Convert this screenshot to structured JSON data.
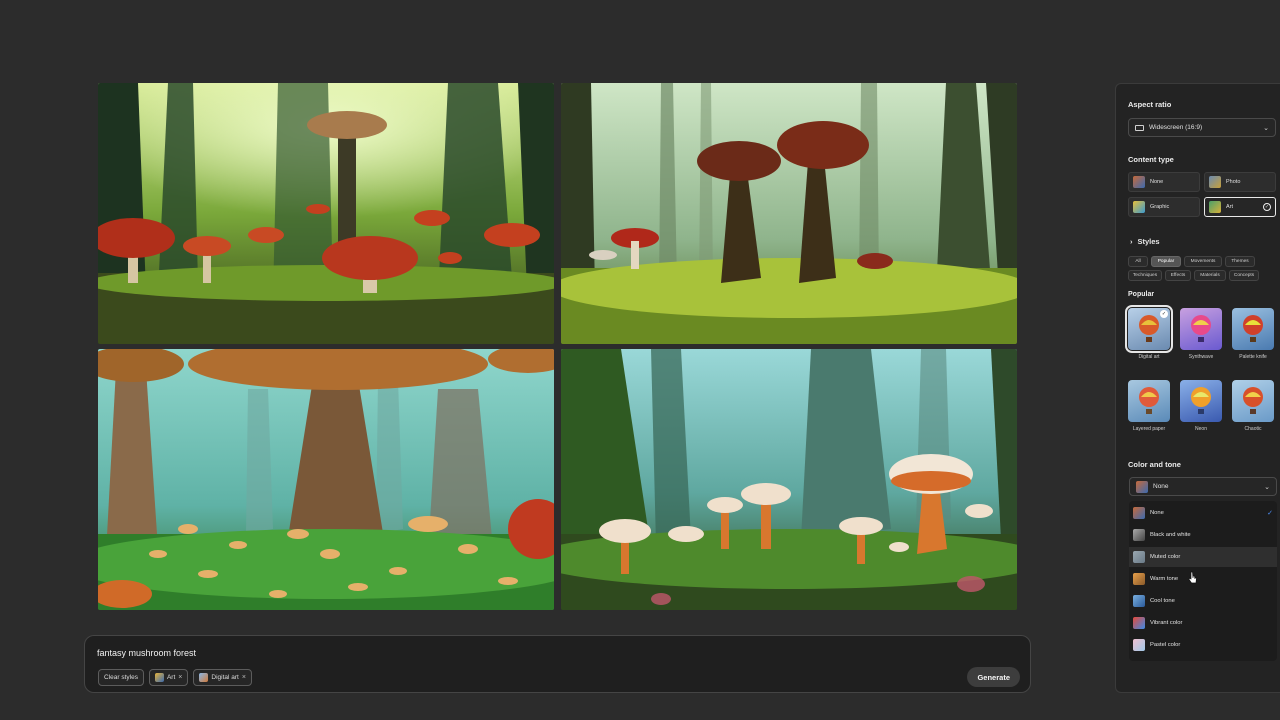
{
  "prompt": {
    "text": "fantasy mushroom forest",
    "chips": [
      {
        "label": "Clear styles"
      },
      {
        "label": "Art",
        "close": "×"
      },
      {
        "label": "Digital art",
        "close": "×"
      }
    ],
    "generate_label": "Generate"
  },
  "panel": {
    "aspect_ratio": {
      "label": "Aspect ratio",
      "value": "Widescreen (16:9)"
    },
    "content_type": {
      "label": "Content type",
      "options": [
        "None",
        "Photo",
        "Graphic",
        "Art"
      ],
      "selected": "Art"
    },
    "styles": {
      "label": "Styles",
      "tabs_row1": [
        "All",
        "Popular",
        "Movements",
        "Themes"
      ],
      "tabs_row2": [
        "Techniques",
        "Effects",
        "Materials",
        "Concepts"
      ],
      "active_tab": "Popular",
      "section_label": "Popular",
      "thumbs_row1": [
        "Digital art",
        "Synthwave",
        "Palette knife"
      ],
      "thumbs_row2": [
        "Layered paper",
        "Neon",
        "Chaotic"
      ],
      "selected": "Digital art"
    },
    "color_tone": {
      "label": "Color and tone",
      "value": "None",
      "options": [
        "None",
        "Black and white",
        "Muted color",
        "Warm tone",
        "Cool tone",
        "Vibrant color",
        "Pastel color"
      ],
      "hovered": "Muted color",
      "checked": "None"
    }
  },
  "icons": {
    "chevron": "chevron-down-icon",
    "check": "checkmark-icon",
    "close": "close-icon",
    "cursor": "mouse-pointer-icon"
  },
  "colors": {
    "background": "#2c2c2c",
    "panel": "#232323",
    "accent_check": "#4d8ff7"
  }
}
